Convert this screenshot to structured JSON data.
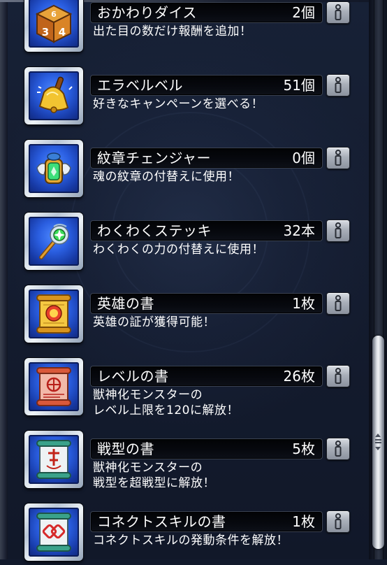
{
  "items": [
    {
      "name": "おかわりダイス",
      "count": "2個",
      "desc": [
        "出た目の数だけ報酬を追加！"
      ],
      "icon": "dice-icon"
    },
    {
      "name": "エラベルベル",
      "count": "51個",
      "desc": [
        "好きなキャンペーンを選べる！"
      ],
      "icon": "bell-icon"
    },
    {
      "name": "紋章チェンジャー",
      "count": "0個",
      "desc": [
        "魂の紋章の付替えに使用！"
      ],
      "icon": "crest-changer-icon"
    },
    {
      "name": "わくわくステッキ",
      "count": "32本",
      "desc": [
        "わくわくの力の付替えに使用！"
      ],
      "icon": "magic-wand-icon"
    },
    {
      "name": "英雄の書",
      "count": "1枚",
      "desc": [
        "英雄の証が獲得可能！"
      ],
      "icon": "hero-scroll-icon"
    },
    {
      "name": "レベルの書",
      "count": "26枚",
      "desc": [
        "獣神化モンスターの",
        "レベル上限を120に解放！"
      ],
      "icon": "level-scroll-icon"
    },
    {
      "name": "戦型の書",
      "count": "5枚",
      "desc": [
        "獣神化モンスターの",
        "戦型を超戦型に解放！"
      ],
      "icon": "battle-type-scroll-icon"
    },
    {
      "name": "コネクトスキルの書",
      "count": "1枚",
      "desc": [
        "コネクトスキルの発動条件を解放！"
      ],
      "icon": "connect-skill-scroll-icon"
    }
  ],
  "dice_faces": [
    "6",
    "3",
    "4"
  ],
  "colors": {
    "icon_background": "#2a5ee0",
    "icon_frame": "#e4ebf2",
    "name_bar": "#05070c",
    "text": "#ffffff",
    "info_button": "#b3b9c3",
    "scroll_thumb": "#e6e9ee"
  }
}
